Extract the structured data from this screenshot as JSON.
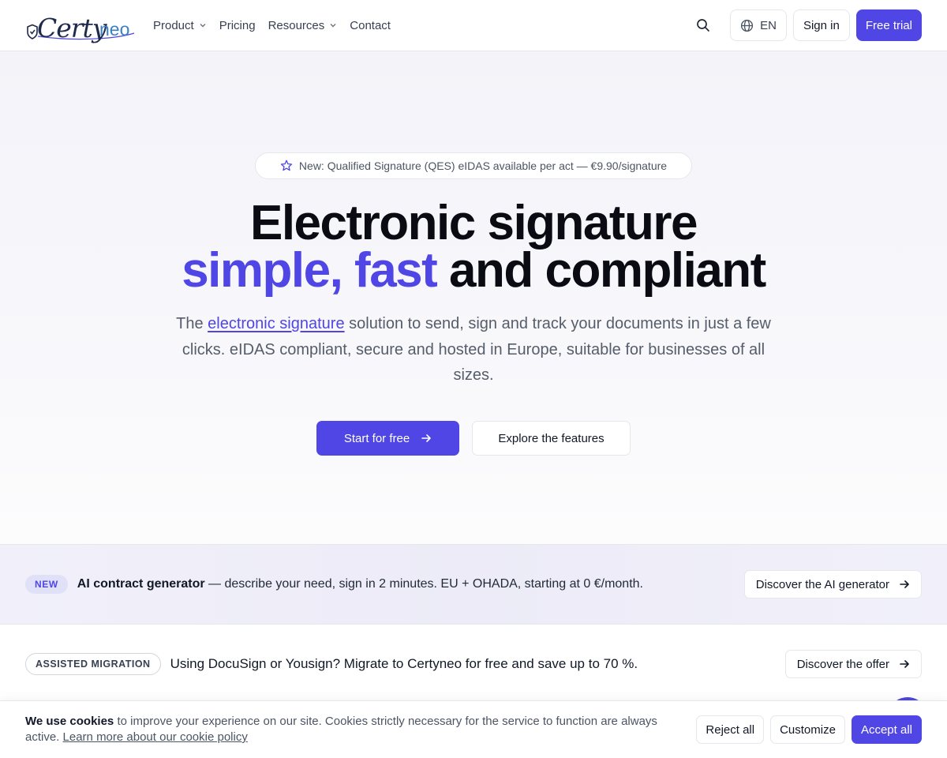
{
  "brand": {
    "name_part1": "Certy",
    "name_part2": "neo",
    "accent_color": "#4f46e5"
  },
  "nav": {
    "items": [
      {
        "label": "Product",
        "has_dropdown": true
      },
      {
        "label": "Pricing",
        "has_dropdown": false
      },
      {
        "label": "Resources",
        "has_dropdown": true
      },
      {
        "label": "Contact",
        "has_dropdown": false
      }
    ],
    "search_icon": "search-icon",
    "language": "EN",
    "sign_in": "Sign in",
    "free_trial": "Free trial"
  },
  "hero": {
    "pill_text": "New: Qualified Signature (QES) eIDAS available per act — €9.90/signature",
    "title_line1": "Electronic signature",
    "title_accent": "simple, fast",
    "title_rest": " and compliant",
    "sub_prefix": "The ",
    "sub_link": "electronic signature",
    "sub_rest": " solution to send, sign and track your documents in just a few clicks. eIDAS compliant, secure and hosted in Europe, suitable for businesses of all sizes.",
    "cta_primary": "Start for free",
    "cta_secondary": "Explore the features"
  },
  "banner_ai": {
    "badge": "NEW",
    "title": "AI contract generator",
    "text": " — describe your need, sign in 2 minutes. EU + OHADA, starting at 0 €/month.",
    "button": "Discover the AI generator"
  },
  "banner_migration": {
    "badge": "ASSISTED MIGRATION",
    "text": "Using DocuSign or Yousign? Migrate to Certyneo for free and save up to 70 %.",
    "button": "Discover the offer"
  },
  "cookie": {
    "bold": "We use cookies",
    "text": " to improve your experience on our site. Cookies strictly necessary for the service to function are always active. ",
    "link": "Learn more about our cookie policy",
    "reject": "Reject all",
    "customize": "Customize",
    "accept": "Accept all"
  }
}
